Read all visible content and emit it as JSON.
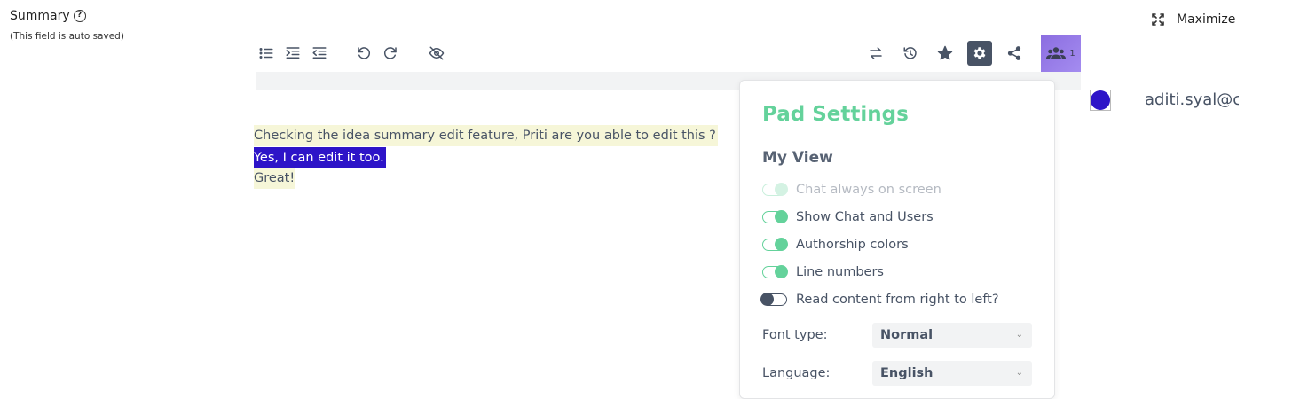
{
  "header": {
    "summary_label": "Summary",
    "help_glyph": "?",
    "autosave_note": "(This field is auto saved)",
    "maximize_label": "Maximize"
  },
  "toolbar": {
    "left_icons": [
      "unordered-list-icon",
      "indent-icon",
      "outdent-icon",
      "undo-icon",
      "redo-icon",
      "hide-authorship-icon"
    ],
    "right_icons": [
      "import-export-icon",
      "timeslider-icon",
      "star-icon",
      "gear-icon",
      "share-icon"
    ],
    "user_count": "1"
  },
  "editor": {
    "lines": [
      "Checking the idea summary edit feature, Priti are you able to edit this ?",
      "Yes, I can edit it too.",
      "Great!"
    ],
    "author_colors": {
      "line1": "#f6f6d8",
      "line2": "#2d14c8",
      "line3": "#f6f6d8"
    }
  },
  "users": {
    "name": "aditi.syal@c",
    "color": "#2d14c8"
  },
  "settings": {
    "title": "Pad Settings",
    "section": "My View",
    "options": [
      {
        "label": "Chat always on screen",
        "on": true,
        "disabled": true
      },
      {
        "label": "Show Chat and Users",
        "on": true,
        "disabled": false
      },
      {
        "label": "Authorship colors",
        "on": true,
        "disabled": false
      },
      {
        "label": "Line numbers",
        "on": true,
        "disabled": false
      },
      {
        "label": "Read content from right to left?",
        "on": false,
        "disabled": false
      }
    ],
    "font_type_label": "Font type:",
    "font_type_value": "Normal",
    "language_label": "Language:",
    "language_value": "English"
  },
  "colors": {
    "accent": "#64d29b",
    "icon": "#485365"
  }
}
